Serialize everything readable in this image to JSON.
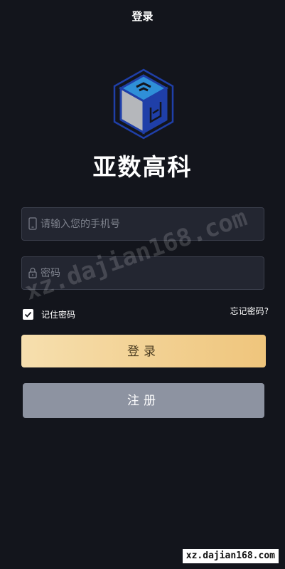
{
  "header": {
    "title": "登录"
  },
  "brand": {
    "name": "亚数高科",
    "logo_icon": "cube-logo-icon"
  },
  "form": {
    "phone": {
      "placeholder": "请输入您的手机号",
      "value": "",
      "icon": "phone-icon"
    },
    "password": {
      "placeholder": "密码",
      "value": "",
      "icon": "lock-icon"
    },
    "remember": {
      "label": "记住密码",
      "checked": true
    },
    "forgot_label": "忘记密码?",
    "login_label": "登录",
    "register_label": "注册"
  },
  "watermark": {
    "text": "xz.dajian168.com",
    "badge": "xz.dajian168.com"
  },
  "colors": {
    "background": "#13151c",
    "input_bg": "#232631",
    "login_gradient_start": "#f6dfae",
    "login_gradient_end": "#efc57c",
    "register_bg": "#8d93a1",
    "logo_blue": "#1f3fa8",
    "logo_light_blue": "#2f8fd8",
    "logo_gray": "#b5b7bb"
  }
}
